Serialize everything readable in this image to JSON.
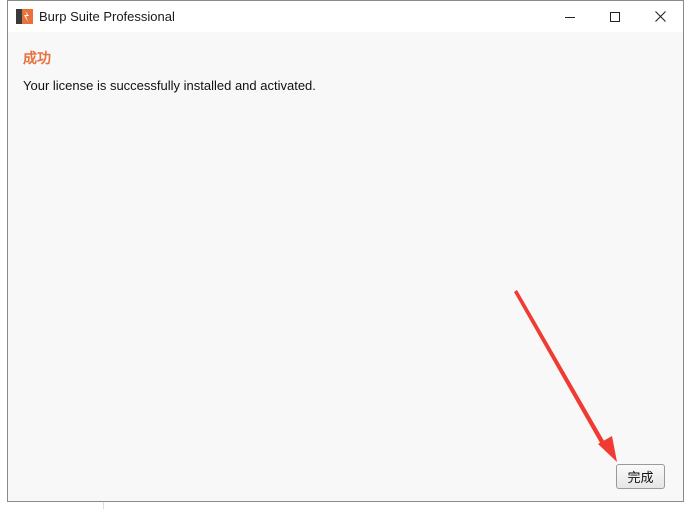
{
  "window": {
    "title": "Burp Suite Professional",
    "icon": "burp-suite-logo-icon"
  },
  "controls": {
    "minimize_icon": "minimize-icon",
    "maximize_icon": "maximize-icon",
    "close_icon": "close-icon"
  },
  "dialog": {
    "heading": "成功",
    "message": "Your license is successfully installed and activated.",
    "finish_label": "完成"
  },
  "colors": {
    "heading": "#e8703a",
    "arrow": "#f03a32"
  }
}
